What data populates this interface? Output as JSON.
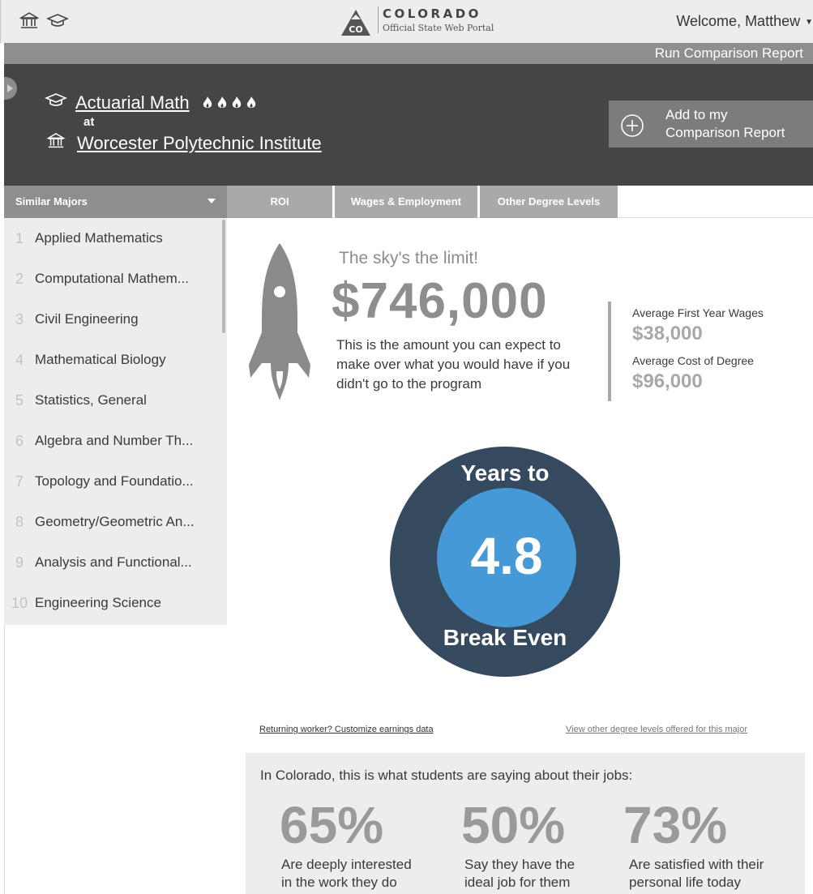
{
  "header": {
    "logo_mark": "CO",
    "portal_title": "COLORADO",
    "portal_subtitle": "Official State Web Portal",
    "welcome": "Welcome, Matthew",
    "icons": [
      "institution-icon",
      "graduation-cap-icon"
    ]
  },
  "run_bar": {
    "label": "Run Comparison Report"
  },
  "hero": {
    "major": "Actuarial Math",
    "flame_count": 4,
    "at": "at",
    "school": "Worcester Polytechnic Institute",
    "add_button": {
      "line1": "Add to my",
      "line2": "Comparison Report"
    }
  },
  "tabs": {
    "similar": "Similar Majors",
    "items": [
      "ROI",
      "Wages & Employment",
      "Other Degree Levels"
    ]
  },
  "similar_majors": [
    {
      "num": "1",
      "name": "Applied Mathematics"
    },
    {
      "num": "2",
      "name": "Computational Mathem..."
    },
    {
      "num": "3",
      "name": "Civil Engineering"
    },
    {
      "num": "4",
      "name": "Mathematical Biology"
    },
    {
      "num": "5",
      "name": "Statistics, General"
    },
    {
      "num": "6",
      "name": "Algebra and Number Th..."
    },
    {
      "num": "7",
      "name": "Topology and Foundatio..."
    },
    {
      "num": "8",
      "name": "Geometry/Geometric An..."
    },
    {
      "num": "9",
      "name": "Analysis and Functional..."
    },
    {
      "num": "10",
      "name": "Engineering Science"
    }
  ],
  "roi": {
    "tagline": "The sky's the limit!",
    "amount": "$746,000",
    "description": "This is the amount you can expect to make over what you would have if you didn't go to the program",
    "first_year_label": "Average First Year Wages",
    "first_year_value": "$38,000",
    "cost_label": "Average Cost of Degree",
    "cost_value": "$96,000"
  },
  "break_even": {
    "top": "Years to",
    "value": "4.8",
    "bottom": "Break Even"
  },
  "links": {
    "customize": "Returning worker? Customize earnings data",
    "other_levels": "View other degree levels offered for this major"
  },
  "survey": {
    "heading": "In Colorado, this is what students are saying about their jobs:",
    "stats": [
      {
        "pct": "65%",
        "line1": "Are deeply interested",
        "line2": "in the work they do"
      },
      {
        "pct": "50%",
        "line1": "Say they have the",
        "line2": "ideal job for them"
      },
      {
        "pct": "73%",
        "line1": "Are satisfied with their",
        "line2": "personal life today"
      }
    ]
  },
  "colors": {
    "dark_header": "#454545",
    "ring_outer": "#364a5f",
    "ring_inner": "#4599d6",
    "muted_text": "#8e8e8e"
  }
}
